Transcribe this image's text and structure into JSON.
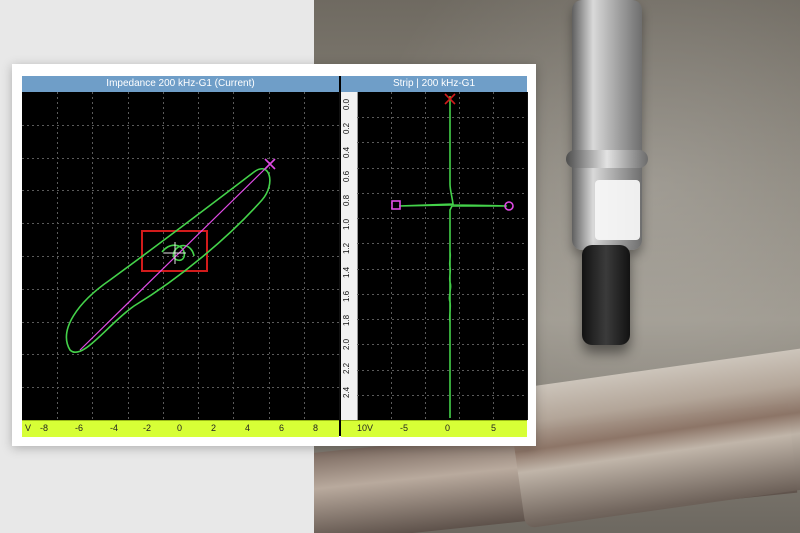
{
  "instrument": {
    "impedance_header": "Impedance 200 kHz-G1 (Current)",
    "strip_header": "Strip | 200 kHz-G1",
    "impedance_x_ticks": [
      "V",
      "-8",
      "-6",
      "-4",
      "-2",
      "0",
      "2",
      "4",
      "6",
      "8"
    ],
    "strip_x_ticks": [
      "10V",
      "-5",
      "0",
      "5"
    ],
    "strip_y_ticks": [
      "0.0",
      "0.2",
      "0.4",
      "0.6",
      "0.8",
      "1.0",
      "1.2",
      "1.4",
      "1.6",
      "1.8",
      "2.0",
      "2.2",
      "2.4"
    ],
    "colors": {
      "header_bg": "#6f9ec8",
      "screen_bg": "#000000",
      "grid": "#5a5a5a",
      "trace_green": "#44d24a",
      "trace_magenta": "#e14be6",
      "roi_red": "#d21b1b",
      "xbar": "#d7ff36"
    }
  }
}
